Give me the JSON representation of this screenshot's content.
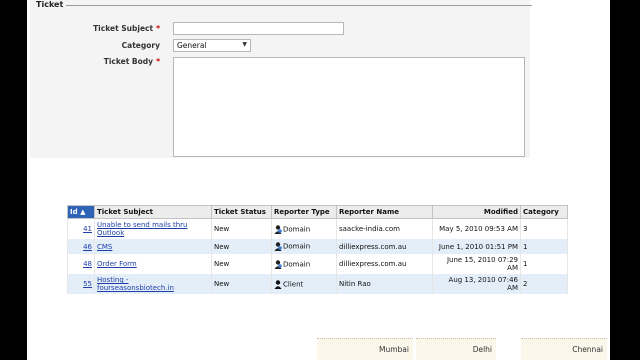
{
  "form": {
    "legend": "Ticket",
    "subject_label": "Ticket Subject",
    "subject_value": "",
    "category_label": "Category",
    "category_value": "General",
    "body_label": "Ticket Body",
    "required_mark": "*"
  },
  "grid": {
    "columns": [
      "Id",
      "Ticket Subject",
      "Ticket Status",
      "Reporter Type",
      "Reporter Name",
      "Modified",
      "Category"
    ],
    "sort_indicator": "▲",
    "rows": [
      {
        "id": "41",
        "subject_l1": "Unable to send mails thru",
        "subject_l2": "Outlook",
        "status": "New",
        "reporter_type": "Domain",
        "reporter_name": "saacke-india.com",
        "modified": "May 5, 2010 09:53 AM",
        "category": "3"
      },
      {
        "id": "46",
        "subject_l1": "CMS",
        "status": "New",
        "reporter_type": "Domain",
        "reporter_name": "dilliexpress.com.au",
        "modified": "June 1, 2010 01:51 PM",
        "category": "1"
      },
      {
        "id": "48",
        "subject_l1": "Order Form",
        "status": "New",
        "reporter_type": "Domain",
        "reporter_name": "dilliexpress.com.au",
        "modified_l1": "June 15, 2010 07:29",
        "modified_l2": "AM",
        "category": "1"
      },
      {
        "id": "55",
        "subject_l1": "Hosting -",
        "subject_l2": "fourseasonsbiotech.in",
        "status": "New",
        "reporter_type": "Client",
        "reporter_name": "Nitin Rao",
        "modified_l1": "Aug 13, 2010 07:46",
        "modified_l2": "AM",
        "category": "2"
      }
    ]
  },
  "footer": {
    "cities": [
      "Mumbai",
      "Delhi",
      "Chennai"
    ]
  },
  "colors": {
    "sorted_header": "#2f63b5",
    "link": "#1d3ea7",
    "row_alt": "#e4eef8",
    "required": "#cc0000"
  }
}
